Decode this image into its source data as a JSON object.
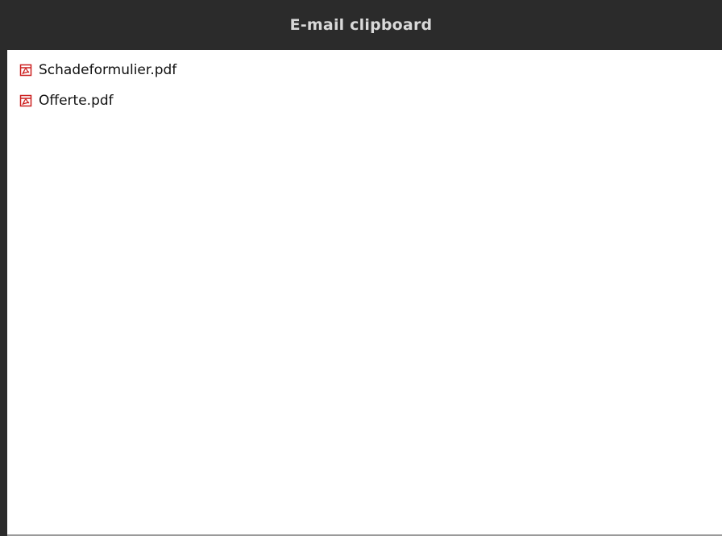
{
  "panel": {
    "title": "E-mail clipboard"
  },
  "files": [
    {
      "name": "Schadeformulier.pdf",
      "icon": "pdf-icon"
    },
    {
      "name": "Offerte.pdf",
      "icon": "pdf-icon"
    }
  ],
  "colors": {
    "title_bar_bg": "#2b2b2b",
    "title_text": "#d9d9d9",
    "pdf_icon_red": "#cc1f1f"
  }
}
